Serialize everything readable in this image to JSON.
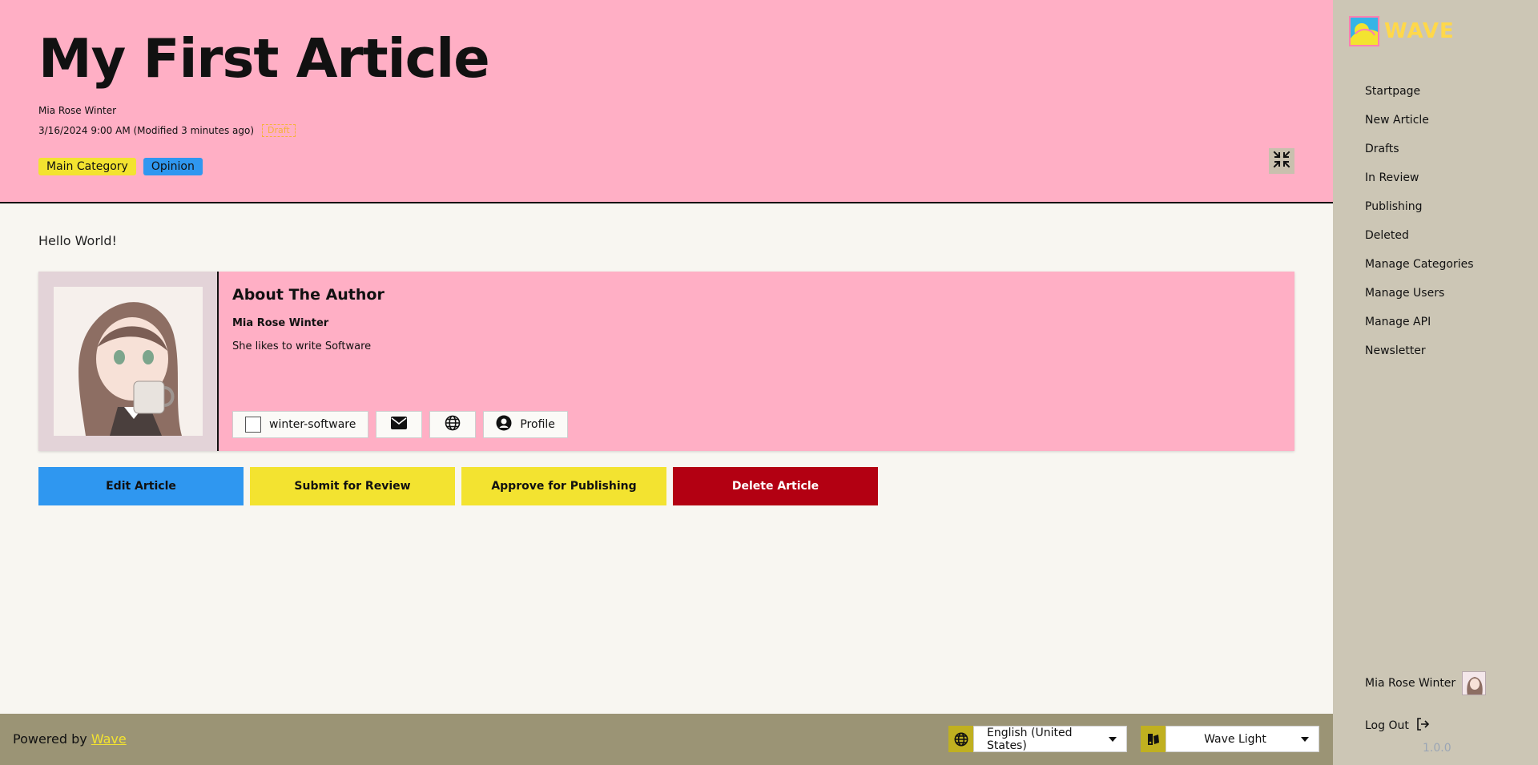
{
  "article": {
    "title": "My First Article",
    "author": "Mia Rose Winter",
    "date": "3/16/2024 9:00 AM (Modified 3 minutes ago)",
    "status_badge": "Draft",
    "categories": [
      "Main Category",
      "Opinion"
    ],
    "body": "Hello World!"
  },
  "author_card": {
    "heading": "About The Author",
    "name": "Mia Rose Winter",
    "bio": "She likes to write Software",
    "links": {
      "github_label": "winter-software",
      "profile_label": "Profile"
    }
  },
  "actions": {
    "edit": "Edit Article",
    "submit": "Submit for Review",
    "approve": "Approve for Publishing",
    "delete": "Delete Article"
  },
  "footer": {
    "powered_prefix": "Powered by ",
    "powered_link": "Wave",
    "language": "English (United States)",
    "theme": "Wave Light"
  },
  "sidebar": {
    "logo_text": "WAVE",
    "nav": [
      "Startpage",
      "New Article",
      "Drafts",
      "In Review",
      "Publishing",
      "Deleted",
      "Manage Categories",
      "Manage Users",
      "Manage API",
      "Newsletter"
    ],
    "user_name": "Mia Rose Winter",
    "logout": "Log Out",
    "version": "1.0.0"
  },
  "colors": {
    "header_pink": "#ffafc5",
    "accent_yellow": "#f3e330",
    "accent_blue": "#2f97f0",
    "danger_red": "#b30012",
    "sidebar_bg": "#ccc6b5",
    "footer_bg": "#9b9475"
  },
  "icons": {
    "collapse": "compress-icon",
    "email": "envelope-icon",
    "website": "globe-icon",
    "profile": "user-circle-icon",
    "language": "globe-icon",
    "theme": "palette-icon",
    "logout": "logout-icon"
  }
}
